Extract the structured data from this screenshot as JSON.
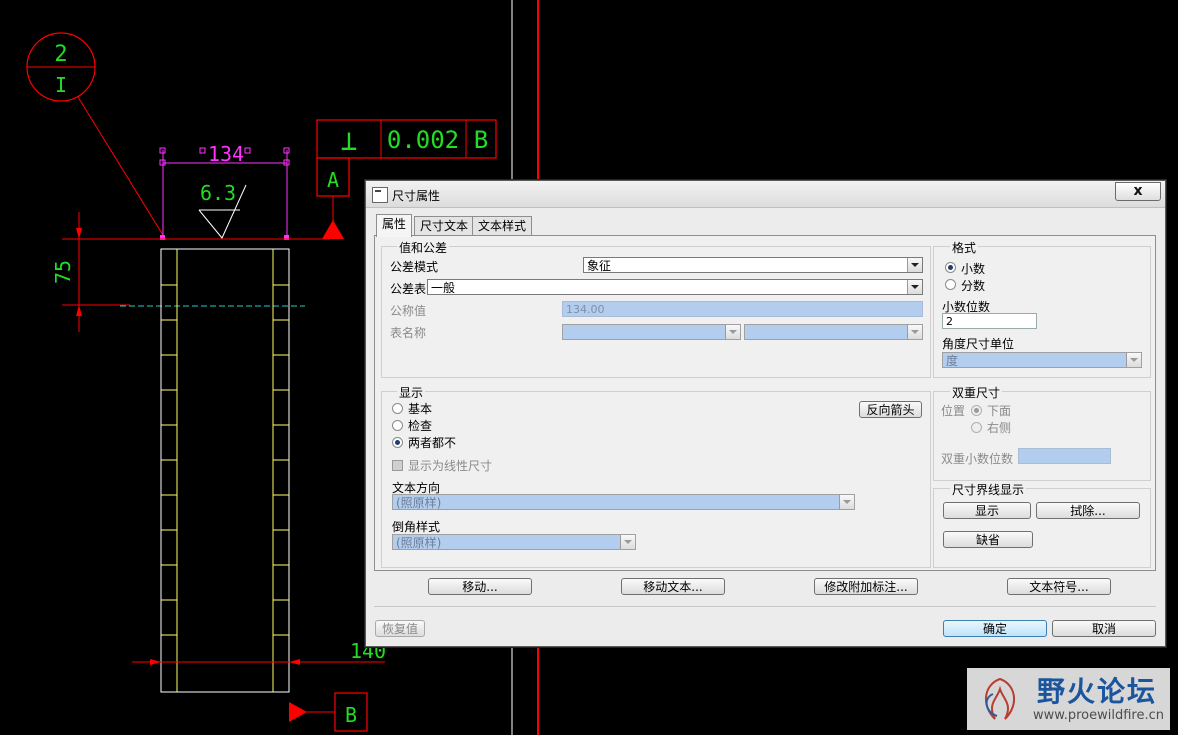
{
  "cad": {
    "balloon_top": "2",
    "balloon_bottom": "I",
    "gdt_symbol": "⊥",
    "gdt_tolerance": "0.002",
    "gdt_datum": "B",
    "datum_a": "A",
    "datum_b": "B",
    "dim_width": "134",
    "dim_roughness": "6.3",
    "dim_height": "75",
    "dim_bottom": "140"
  },
  "dialog": {
    "title": "尺寸属性",
    "close": "x",
    "tabs": [
      "属性",
      "尺寸文本",
      "文本样式"
    ],
    "group_value": {
      "title": "值和公差",
      "tolerance_mode_label": "公差模式",
      "tolerance_mode_value": "象征",
      "tolerance_table_label": "公差表",
      "tolerance_table_value": "一般",
      "nominal_label": "公称值",
      "nominal_value": "134.00",
      "table_name_label": "表名称"
    },
    "group_format": {
      "title": "格式",
      "decimal": "小数",
      "fraction": "分数",
      "decimals_label": "小数位数",
      "decimals_value": "2",
      "angle_unit_label": "角度尺寸单位",
      "angle_unit_value": "度"
    },
    "group_display": {
      "title": "显示",
      "basic": "基本",
      "inspection": "检查",
      "neither": "两者都不",
      "flip_arrows": "反向箭头",
      "show_linear": "显示为线性尺寸",
      "text_dir_label": "文本方向",
      "text_dir_value": "(照原样)",
      "chamfer_label": "倒角样式",
      "chamfer_value": "(照原样)"
    },
    "group_dual": {
      "title": "双重尺寸",
      "position_label": "位置",
      "below": "下面",
      "right": "右侧",
      "dual_decimals_label": "双重小数位数"
    },
    "group_witness": {
      "title": "尺寸界线显示",
      "show": "显示",
      "erase": "拭除...",
      "default": "缺省"
    },
    "actions": {
      "move": "移动...",
      "move_text": "移动文本...",
      "modify_attached": "修改附加标注...",
      "text_symbol": "文本符号..."
    },
    "footer": {
      "restore": "恢复值",
      "ok": "确定",
      "cancel": "取消"
    }
  },
  "watermark": {
    "title": "野火论坛",
    "url": "www.proewildfire.cn"
  },
  "colors": {
    "cad_red": "#ff0000",
    "cad_green": "#22dd22",
    "cad_magenta": "#ff33ff",
    "cad_yellow": "#ffff66",
    "cad_white": "#ffffff",
    "cad_cyan": "#22cccc"
  }
}
